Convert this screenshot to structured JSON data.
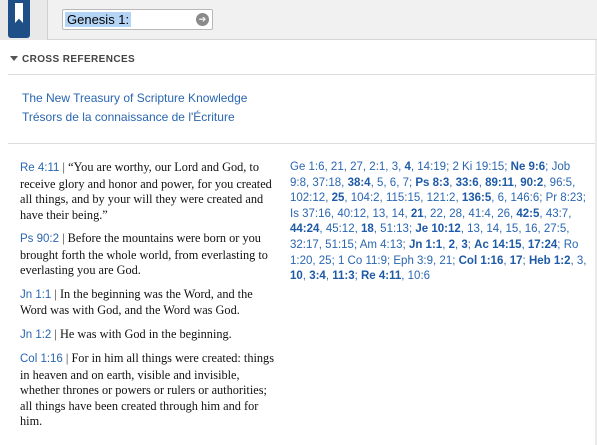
{
  "toolbar": {
    "reference_value": "Genesis 1:1",
    "go_icon": "arrow-right-icon",
    "book_icon": "bookmark-icon"
  },
  "section": {
    "title": "CROSS REFERENCES"
  },
  "resources": [
    "The New Treasury of Scripture Knowledge",
    "Trésors de la connaissance de l'Écriture"
  ],
  "verses": [
    {
      "ref": "Re 4:11",
      "text": "“You are worthy, our Lord and God,  to receive glory and honor and power, for you created all things,  and by your will they were created  and have their being.”"
    },
    {
      "ref": "Ps 90:2",
      "text": "Before the mountains were born or you brought forth the whole world,  from everlasting to everlasting you are God."
    },
    {
      "ref": "Jn 1:1",
      "text": "In the beginning was the Word, and the Word was with God, and the Word was God."
    },
    {
      "ref": "Jn 1:2",
      "text": "He was with God in the beginning."
    },
    {
      "ref": "Col 1:16",
      "text": "For in him all things were created: things in heaven and on earth, visible and invisible, whether thrones or powers or rulers or authorities; all things have been created through him and for him."
    }
  ],
  "cross_refs": [
    {
      "t": "Ge 1:6",
      "b": false
    },
    {
      "t": ", ",
      "p": true
    },
    {
      "t": "21",
      "b": false
    },
    {
      "t": ", ",
      "p": true
    },
    {
      "t": "27",
      "b": false
    },
    {
      "t": ", ",
      "p": true
    },
    {
      "t": "2:1",
      "b": false
    },
    {
      "t": ", ",
      "p": true
    },
    {
      "t": "3",
      "b": false
    },
    {
      "t": ", ",
      "p": true
    },
    {
      "t": "4",
      "b": true
    },
    {
      "t": ", ",
      "p": true
    },
    {
      "t": "14:19",
      "b": false
    },
    {
      "t": "; ",
      "p": true
    },
    {
      "t": "2 Ki 19:15",
      "b": false
    },
    {
      "t": "; ",
      "p": true
    },
    {
      "t": "Ne 9:6",
      "b": true
    },
    {
      "t": "; ",
      "p": true
    },
    {
      "t": "Job 9:8",
      "b": false
    },
    {
      "t": ", ",
      "p": true
    },
    {
      "t": "37:18",
      "b": false
    },
    {
      "t": ", ",
      "p": true
    },
    {
      "t": "38:4",
      "b": true
    },
    {
      "t": ", ",
      "p": true
    },
    {
      "t": "5",
      "b": false
    },
    {
      "t": ", ",
      "p": true
    },
    {
      "t": "6",
      "b": false
    },
    {
      "t": ", ",
      "p": true
    },
    {
      "t": "7",
      "b": false
    },
    {
      "t": "; ",
      "p": true
    },
    {
      "t": "Ps 8:3",
      "b": true
    },
    {
      "t": ", ",
      "p": true
    },
    {
      "t": "33:6",
      "b": true
    },
    {
      "t": ", ",
      "p": true
    },
    {
      "t": "89:11",
      "b": true
    },
    {
      "t": ", ",
      "p": true
    },
    {
      "t": "90:2",
      "b": true
    },
    {
      "t": ", ",
      "p": true
    },
    {
      "t": "96:5",
      "b": false
    },
    {
      "t": ", ",
      "p": true
    },
    {
      "t": "102:12",
      "b": false
    },
    {
      "t": ", ",
      "p": true
    },
    {
      "t": "25",
      "b": true
    },
    {
      "t": ", ",
      "p": true
    },
    {
      "t": "104:2",
      "b": false
    },
    {
      "t": ", ",
      "p": true
    },
    {
      "t": "115:15",
      "b": false
    },
    {
      "t": ", ",
      "p": true
    },
    {
      "t": "121:2",
      "b": false
    },
    {
      "t": ", ",
      "p": true
    },
    {
      "t": "136:5",
      "b": true
    },
    {
      "t": ", ",
      "p": true
    },
    {
      "t": "6",
      "b": false
    },
    {
      "t": ", ",
      "p": true
    },
    {
      "t": "146:6",
      "b": false
    },
    {
      "t": "; ",
      "p": true
    },
    {
      "t": "Pr 8:23",
      "b": false
    },
    {
      "t": "; ",
      "p": true
    },
    {
      "t": "Is 37:16",
      "b": false
    },
    {
      "t": ", ",
      "p": true
    },
    {
      "t": "40:12",
      "b": false
    },
    {
      "t": ", ",
      "p": true
    },
    {
      "t": "13",
      "b": false
    },
    {
      "t": ", ",
      "p": true
    },
    {
      "t": "14",
      "b": false
    },
    {
      "t": ", ",
      "p": true
    },
    {
      "t": "21",
      "b": true
    },
    {
      "t": ", ",
      "p": true
    },
    {
      "t": "22",
      "b": false
    },
    {
      "t": ", ",
      "p": true
    },
    {
      "t": "28",
      "b": false
    },
    {
      "t": ", ",
      "p": true
    },
    {
      "t": "41:4",
      "b": false
    },
    {
      "t": ", ",
      "p": true
    },
    {
      "t": "26",
      "b": false
    },
    {
      "t": ", ",
      "p": true
    },
    {
      "t": "42:5",
      "b": true
    },
    {
      "t": ", ",
      "p": true
    },
    {
      "t": "43:7",
      "b": false
    },
    {
      "t": ", ",
      "p": true
    },
    {
      "t": "44:24",
      "b": true
    },
    {
      "t": ", ",
      "p": true
    },
    {
      "t": "45:12",
      "b": false
    },
    {
      "t": ", ",
      "p": true
    },
    {
      "t": "18",
      "b": true
    },
    {
      "t": ", ",
      "p": true
    },
    {
      "t": "51:13",
      "b": false
    },
    {
      "t": "; ",
      "p": true
    },
    {
      "t": "Je 10:12",
      "b": true
    },
    {
      "t": ", ",
      "p": true
    },
    {
      "t": "13",
      "b": false
    },
    {
      "t": ", ",
      "p": true
    },
    {
      "t": "14",
      "b": false
    },
    {
      "t": ", ",
      "p": true
    },
    {
      "t": "15",
      "b": false
    },
    {
      "t": ", ",
      "p": true
    },
    {
      "t": "16",
      "b": false
    },
    {
      "t": ", ",
      "p": true
    },
    {
      "t": "27:5",
      "b": false
    },
    {
      "t": ", ",
      "p": true
    },
    {
      "t": "32:17",
      "b": false
    },
    {
      "t": ", ",
      "p": true
    },
    {
      "t": "51:15",
      "b": false
    },
    {
      "t": "; ",
      "p": true
    },
    {
      "t": "Am 4:13",
      "b": false
    },
    {
      "t": "; ",
      "p": true
    },
    {
      "t": "Jn 1:1",
      "b": true
    },
    {
      "t": ", ",
      "p": true
    },
    {
      "t": "2",
      "b": true
    },
    {
      "t": ", ",
      "p": true
    },
    {
      "t": "3",
      "b": true
    },
    {
      "t": "; ",
      "p": true
    },
    {
      "t": "Ac 14:15",
      "b": true
    },
    {
      "t": ", ",
      "p": true
    },
    {
      "t": "17:24",
      "b": true
    },
    {
      "t": "; ",
      "p": true
    },
    {
      "t": "Ro",
      "b": false
    },
    {
      "t": " ",
      "p": true
    },
    {
      "t": "1:20",
      "b": false
    },
    {
      "t": ", ",
      "p": true
    },
    {
      "t": "25",
      "b": false
    },
    {
      "t": "; ",
      "p": true
    },
    {
      "t": "1 Co 11:9",
      "b": false
    },
    {
      "t": "; ",
      "p": true
    },
    {
      "t": "Eph 3:9",
      "b": false
    },
    {
      "t": ", ",
      "p": true
    },
    {
      "t": "21",
      "b": false
    },
    {
      "t": "; ",
      "p": true
    },
    {
      "t": "Col 1:16",
      "b": true
    },
    {
      "t": ", ",
      "p": true
    },
    {
      "t": "17",
      "b": true
    },
    {
      "t": "; ",
      "p": true
    },
    {
      "t": "Heb 1:2",
      "b": true
    },
    {
      "t": ", ",
      "p": true
    },
    {
      "t": "3",
      "b": false
    },
    {
      "t": ", ",
      "p": true
    },
    {
      "t": "10",
      "b": true
    },
    {
      "t": ", ",
      "p": true
    },
    {
      "t": "3:4",
      "b": true
    },
    {
      "t": ", ",
      "p": true
    },
    {
      "t": "11:3",
      "b": true
    },
    {
      "t": "; ",
      "p": true
    },
    {
      "t": "Re 4:11",
      "b": true
    },
    {
      "t": ", ",
      "p": true
    },
    {
      "t": "10:6",
      "b": false
    }
  ]
}
